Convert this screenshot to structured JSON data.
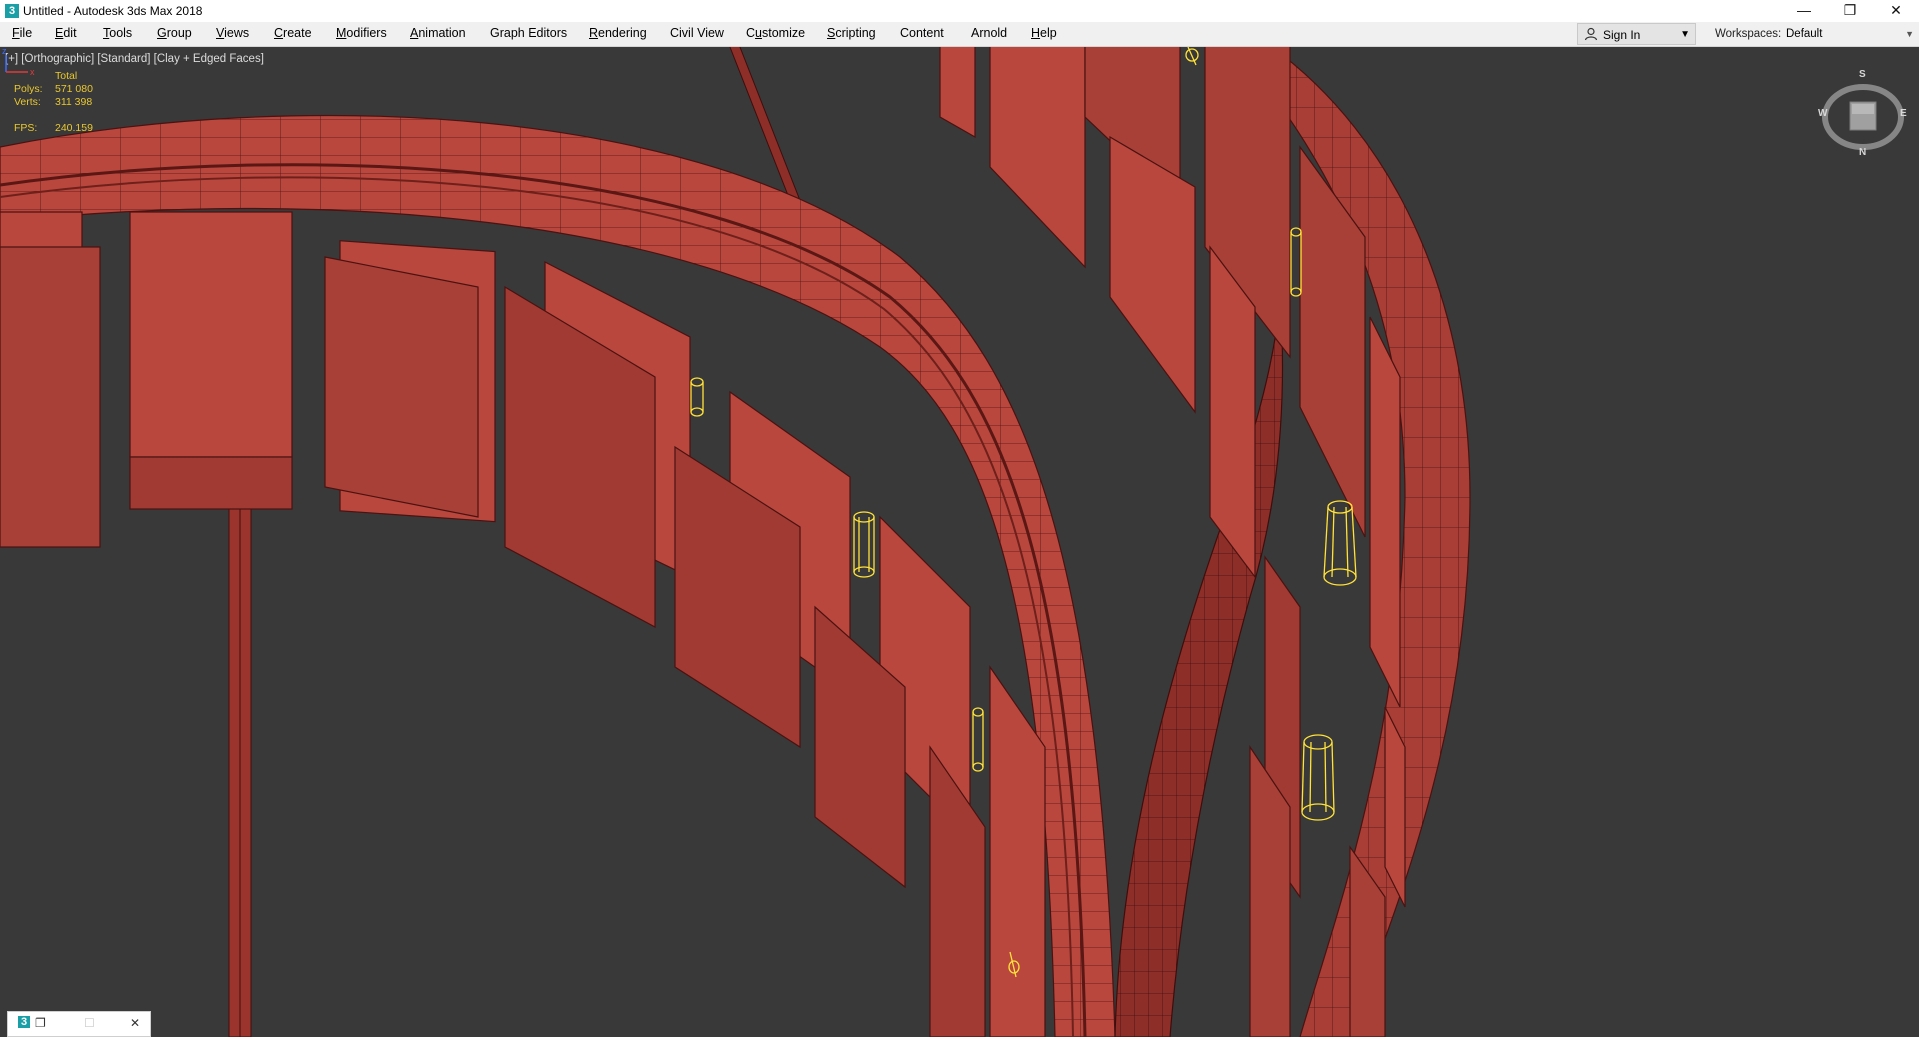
{
  "window": {
    "title": "Untitled - Autodesk 3ds Max 2018",
    "app_icon_glyph": "3",
    "controls": {
      "minimize": "—",
      "restore": "❐",
      "close": "✕"
    }
  },
  "menu": {
    "items": [
      {
        "label": "File",
        "access": "F"
      },
      {
        "label": "Edit",
        "access": "E"
      },
      {
        "label": "Tools",
        "access": "T"
      },
      {
        "label": "Group",
        "access": "G"
      },
      {
        "label": "Views",
        "access": "V"
      },
      {
        "label": "Create",
        "access": "C"
      },
      {
        "label": "Modifiers",
        "access": "M"
      },
      {
        "label": "Animation",
        "access": "A"
      },
      {
        "label": "Graph Editors",
        "access": "D"
      },
      {
        "label": "Rendering",
        "access": "R"
      },
      {
        "label": "Civil View",
        "access": ""
      },
      {
        "label": "Customize",
        "access": "u"
      },
      {
        "label": "Scripting",
        "access": "S"
      },
      {
        "label": "Content",
        "access": ""
      },
      {
        "label": "Arnold",
        "access": ""
      },
      {
        "label": "Help",
        "access": "H"
      }
    ],
    "sign_in": "Sign In",
    "workspaces_label": "Workspaces:",
    "workspace_value": "Default"
  },
  "viewport": {
    "label": "[+] [Orthographic] [Standard] [Clay + Edged Faces]",
    "stats": {
      "header": "Total",
      "polys_label": "Polys:",
      "polys_value": "571 080",
      "verts_label": "Verts:",
      "verts_value": "311 398",
      "fps_label": "FPS:",
      "fps_value": "240.159"
    },
    "viewcube": {
      "top": "S",
      "left": "W",
      "right": "E",
      "bottom": "N"
    },
    "tripod": {
      "x": "x",
      "z": "z"
    }
  },
  "colors": {
    "viewport_bg": "#393939",
    "clay": "#b9473e",
    "clay_dark": "#8e2e28",
    "wire": "#4a1210",
    "light_gizmo": "#ffe23a",
    "stats_text": "#e9c830"
  },
  "minimized_window": {
    "icon_glyph": "3",
    "restore": "❐",
    "maximize": "☐",
    "close": "✕"
  }
}
